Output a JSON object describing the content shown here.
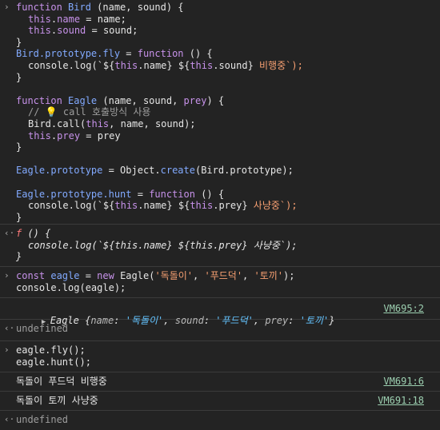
{
  "entries": {
    "code1": {
      "lines": [
        [
          "function ",
          "Bird",
          " (name, sound) {"
        ],
        [
          "this",
          ".",
          "name",
          " = name;"
        ],
        [
          "this",
          ".",
          "sound",
          " = sound;"
        ],
        [
          "}"
        ],
        [
          "Bird.prototype.fly",
          " = ",
          "function",
          " () {"
        ],
        [
          "console.log(`${",
          "this",
          ".name} ${",
          "this",
          ".sound}",
          " 비행중`);"
        ],
        [
          "}"
        ],
        [
          ""
        ],
        [
          "function ",
          "Eagle",
          " (name, sound, ",
          "prey",
          ") {"
        ],
        [
          "// ",
          "💡",
          " call 호출방식 사용"
        ],
        [
          "Bird.call(",
          "this",
          ", name, sound);"
        ],
        [
          "this",
          ".",
          "prey",
          " = prey"
        ],
        [
          "}"
        ],
        [
          ""
        ],
        [
          "Eagle.prototype",
          " = Object.",
          "create",
          "(Bird.prototype);"
        ],
        [
          ""
        ],
        [
          "Eagle.prototype.hunt",
          " = ",
          "function",
          " () {"
        ],
        [
          "console.log(`${",
          "this",
          ".name} ${",
          "this",
          ".prey}",
          " 사냥중`);"
        ],
        [
          "}"
        ]
      ]
    },
    "result1": {
      "f": "f",
      "sig": " () {",
      "body": "console.log(`${this.name} ${this.prey} 사냥중`);",
      "close": "}"
    },
    "code2": {
      "l1a": "const ",
      "l1b": "eagle",
      "l1c": " = ",
      "l1d": "new ",
      "l1e": "Eagle(",
      "s1": "'독돌이'",
      "s2": "'푸드덕'",
      "s3": "'토끼'",
      "l1end": ");",
      "l2": "console.log(eagle);"
    },
    "log1": {
      "type": "Eagle",
      "k1": "name",
      "v1": "'독돌이'",
      "k2": "sound",
      "v2": "'푸드덕'",
      "k3": "prey",
      "v3": "'토끼'",
      "source": "VM695:2"
    },
    "undefined1": "undefined",
    "code3": {
      "l1": "eagle.fly();",
      "l2": "eagle.hunt();"
    },
    "out1": {
      "text": "독돌이 푸드덕 비행중",
      "source": "VM691:6"
    },
    "out2": {
      "text": "독돌이 토끼 사냥중",
      "source": "VM691:18"
    },
    "undefined2": "undefined"
  }
}
